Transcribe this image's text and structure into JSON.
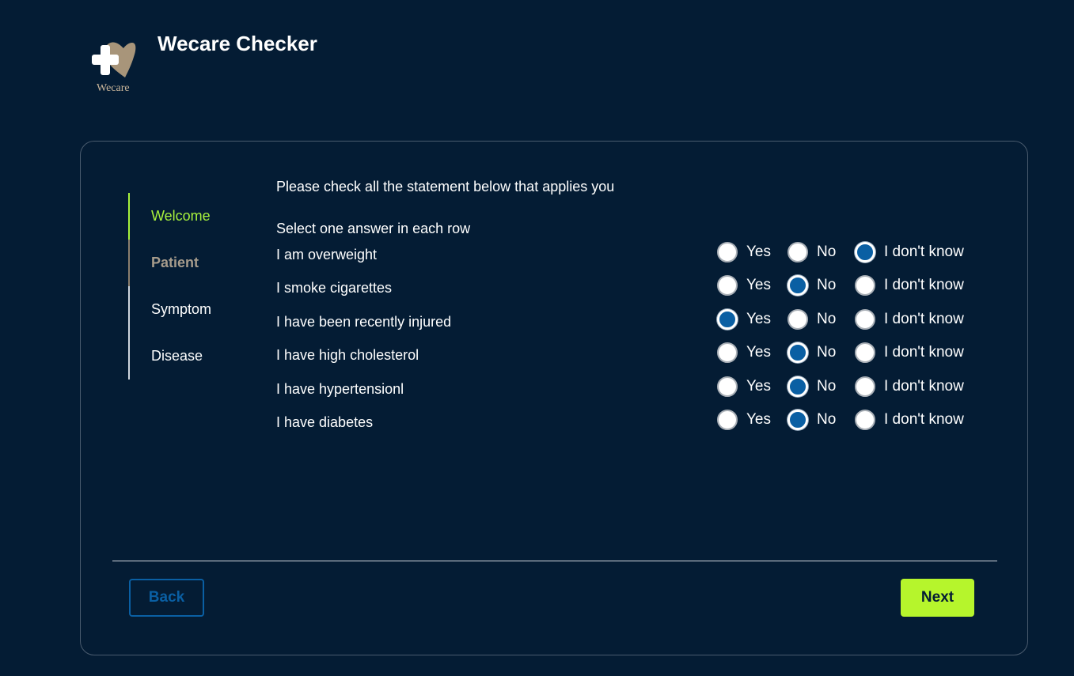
{
  "app": {
    "title": "Wecare Checker",
    "logo_text": "Wecare"
  },
  "steps": [
    {
      "label": "Welcome",
      "state": "active"
    },
    {
      "label": "Patient",
      "state": "done"
    },
    {
      "label": "Symptom",
      "state": "pending"
    },
    {
      "label": "Disease",
      "state": "pending"
    }
  ],
  "form": {
    "instruction": "Please check all the statement below that applies you",
    "sub_instruction": "Select one answer in each row",
    "options": [
      "Yes",
      "No",
      "I don't know"
    ],
    "questions": [
      {
        "text": "I am overweight",
        "selected": "I don't know"
      },
      {
        "text": "I smoke cigarettes",
        "selected": "No"
      },
      {
        "text": "I have been recently injured",
        "selected": "Yes"
      },
      {
        "text": "I have high cholesterol",
        "selected": "No"
      },
      {
        "text": "I have hypertensionl",
        "selected": "No"
      },
      {
        "text": "I have diabetes",
        "selected": "No"
      }
    ]
  },
  "buttons": {
    "back": "Back",
    "next": "Next"
  },
  "colors": {
    "background": "#041c34",
    "accent": "#a8f23c",
    "primary": "#0a5fa3",
    "logo": "#a8957a"
  }
}
